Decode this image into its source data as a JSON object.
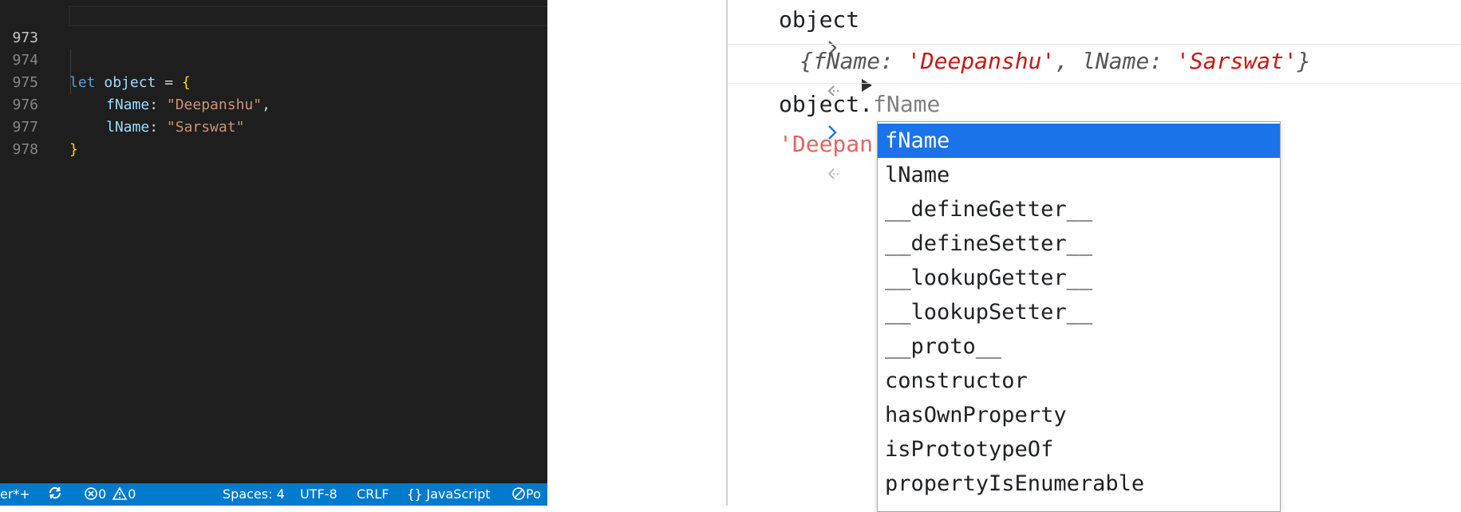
{
  "editor": {
    "lines": [
      {
        "num": "973"
      },
      {
        "num": "974",
        "kw": "let",
        "var": "object",
        "eq": " = ",
        "brace": "{"
      },
      {
        "num": "975",
        "prop": "fName",
        "colon": ": ",
        "str": "\"Deepanshu\"",
        "comma": ","
      },
      {
        "num": "976",
        "prop": "lName",
        "colon": ": ",
        "str": "\"Sarswat\""
      },
      {
        "num": "977",
        "brace": "}"
      },
      {
        "num": "978"
      }
    ]
  },
  "statusbar": {
    "left_fragment": "er*+",
    "errors": "0",
    "warnings": "0",
    "spaces": "Spaces: 4",
    "encoding": "UTF-8",
    "eol": "CRLF",
    "language": "JavaScript",
    "right_fragment": "Po",
    "background": "#007acc"
  },
  "console": {
    "row1_input": "object",
    "row2": {
      "open": "{",
      "k1": "fName",
      "sep": ": ",
      "v1": "'Deepanshu'",
      "comma": ", ",
      "k2": "lName",
      "v2": "'Sarswat'",
      "close": "}"
    },
    "row3_typed": "object.",
    "row3_ghost": "fName",
    "row4_result": "'Deepan"
  },
  "autocomplete": {
    "selected_index": 0,
    "items": [
      "fName",
      "lName",
      "__defineGetter__",
      "__defineSetter__",
      "__lookupGetter__",
      "__lookupSetter__",
      "__proto__",
      "constructor",
      "hasOwnProperty",
      "isPrototypeOf",
      "propertyIsEnumerable"
    ],
    "highlight_color": "#1a73e8"
  }
}
